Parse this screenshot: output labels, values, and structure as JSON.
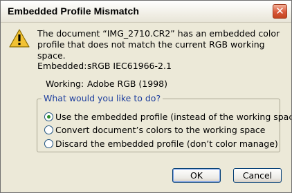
{
  "window": {
    "title": "Embedded Profile Mismatch",
    "close_glyph": "✕"
  },
  "message": "The document “IMG_2710.CR2” has an embedded color profile that does not match the current RGB working space.",
  "profile_info": {
    "embedded": {
      "label": "Embedded:",
      "value": "sRGB IEC61966-2.1"
    },
    "working": {
      "label": "Working:",
      "value": "Adobe RGB (1998)"
    }
  },
  "options_group": {
    "legend": "What would you like to do?",
    "options": [
      {
        "label": "Use the embedded profile (instead of the working space)",
        "selected": true
      },
      {
        "label": "Convert document’s colors to the working space",
        "selected": false
      },
      {
        "label": "Discard the embedded profile (don’t color manage)",
        "selected": false
      }
    ]
  },
  "buttons": {
    "ok": "OK",
    "cancel": "Cancel"
  },
  "icons": {
    "warning": "warning-icon",
    "close": "close-icon"
  }
}
